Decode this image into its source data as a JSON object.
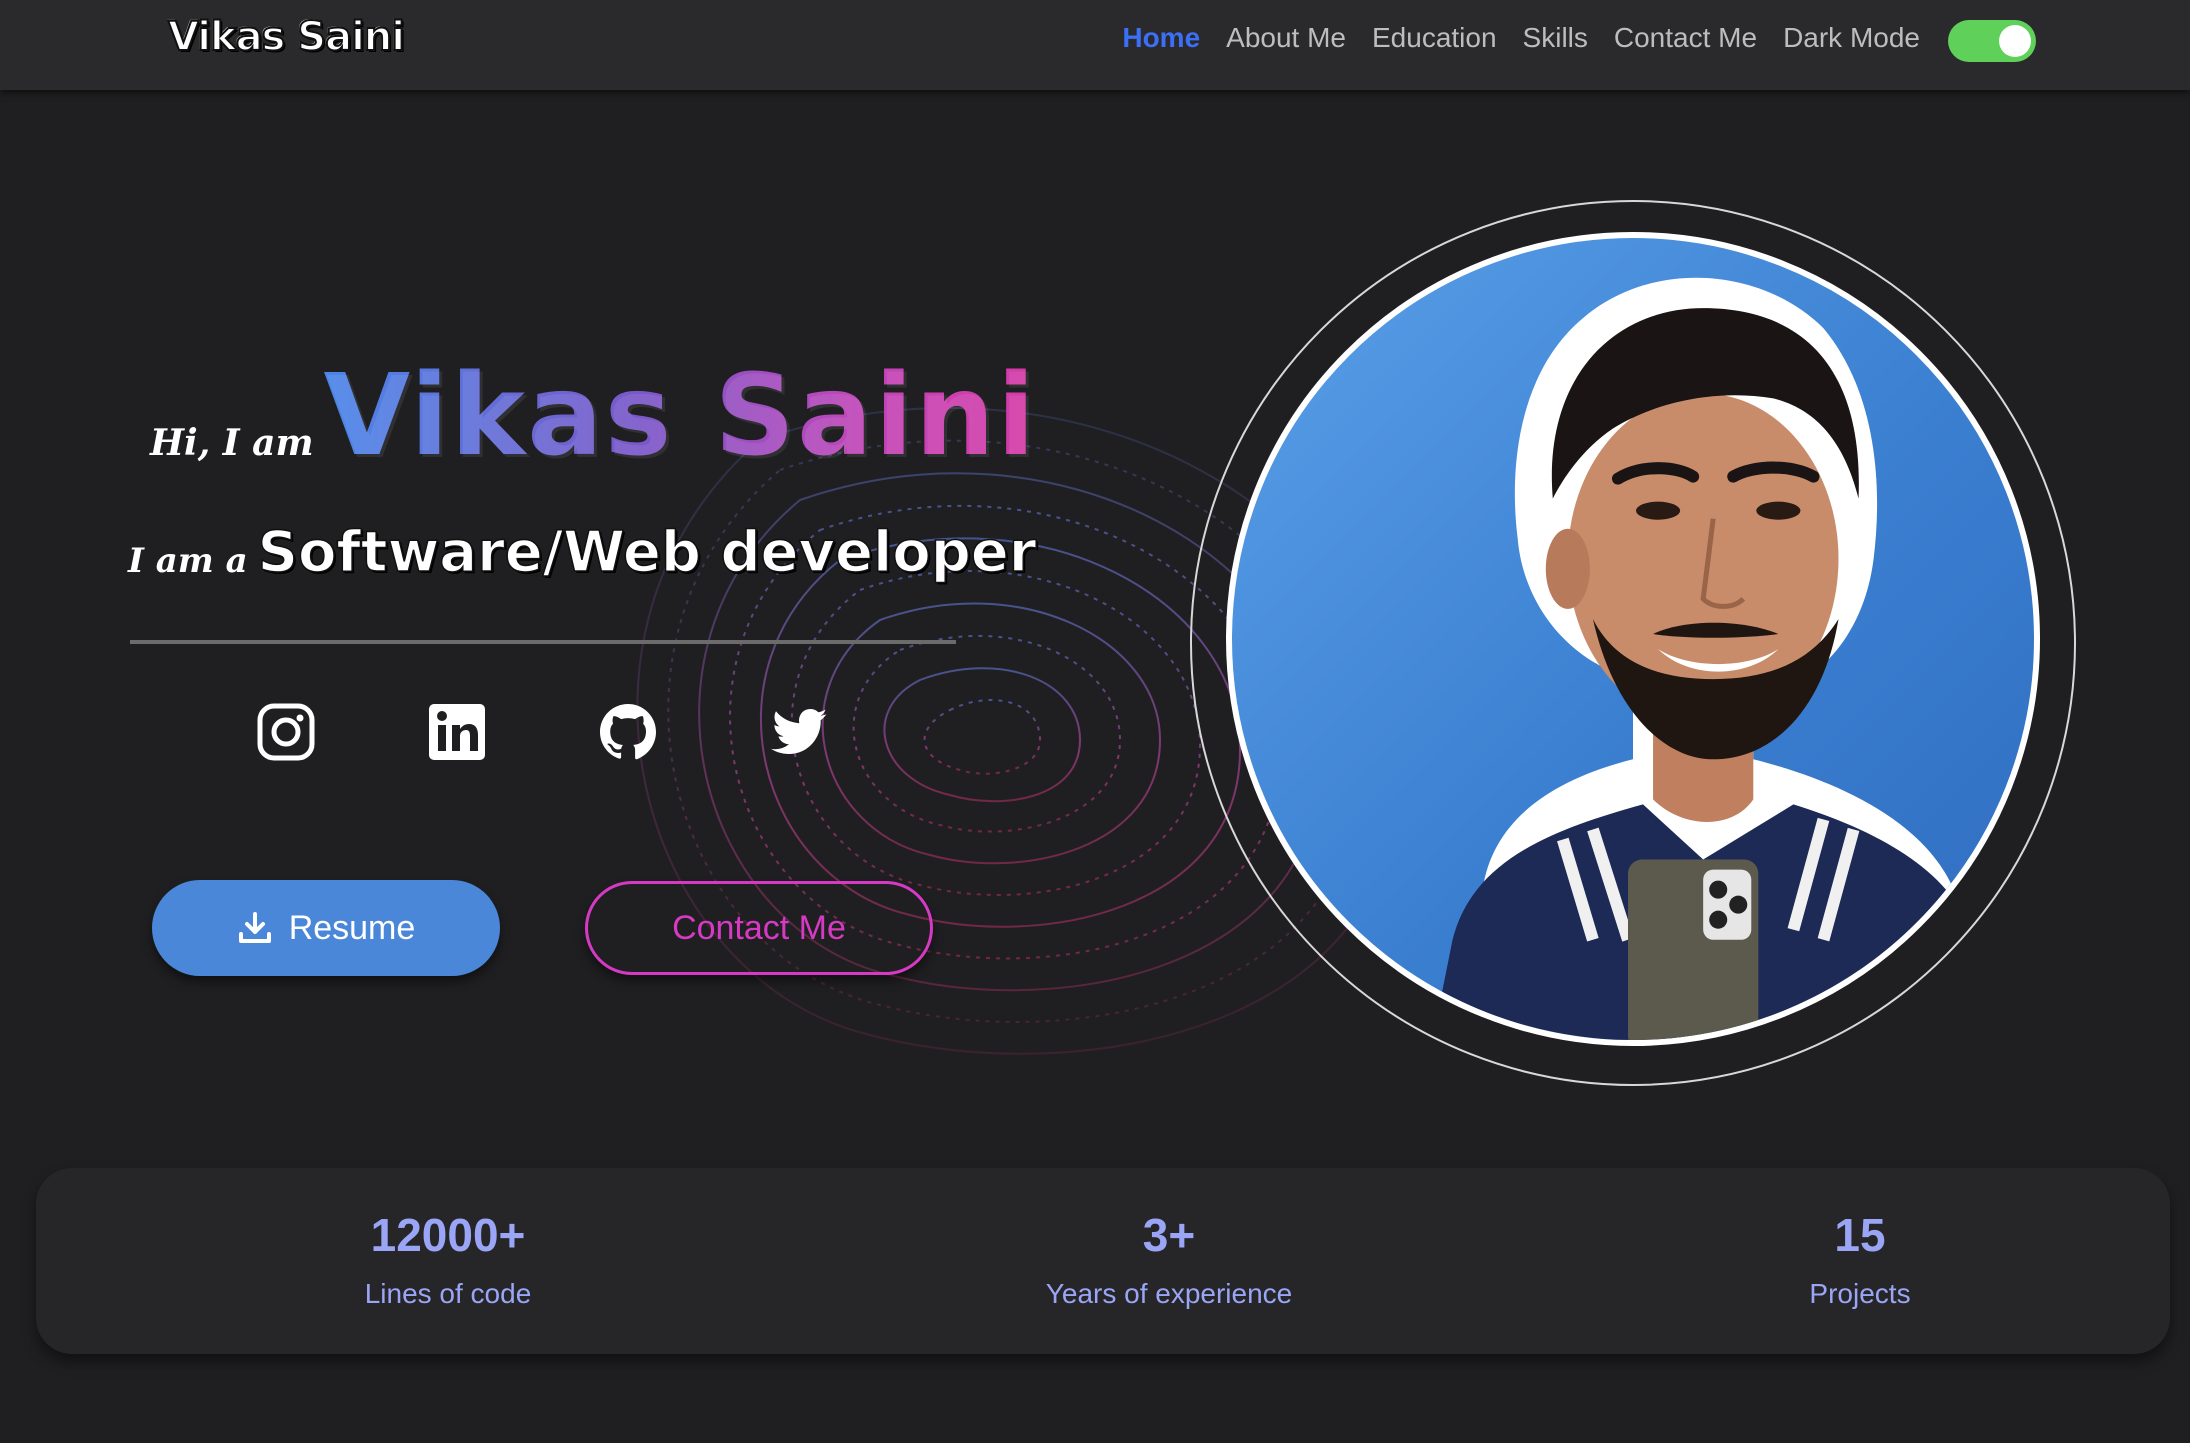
{
  "navbar": {
    "brand": "Vikas Saini",
    "links": [
      "Home",
      "About Me",
      "Education",
      "Skills",
      "Contact Me"
    ],
    "active_link": "Home",
    "dark_mode_label": "Dark Mode",
    "dark_mode_on": true
  },
  "hero": {
    "greeting": "Hi, I am",
    "name": "Vikas Saini",
    "role_prefix": "I am a",
    "role": "Software/Web developer"
  },
  "social": [
    {
      "icon": "instagram-icon"
    },
    {
      "icon": "linkedin-icon"
    },
    {
      "icon": "github-icon"
    },
    {
      "icon": "twitter-icon"
    }
  ],
  "buttons": {
    "resume_label": "Resume",
    "resume_icon": "download-icon",
    "contact_label": "Contact Me"
  },
  "stats": [
    {
      "value": "12000+",
      "label": "Lines of code"
    },
    {
      "value": "3+",
      "label": "Years of experience"
    },
    {
      "value": "15",
      "label": "Projects"
    }
  ],
  "colors": {
    "background": "#1f1f21",
    "navbar": "#2a2a2c",
    "active_link": "#3b6ff5",
    "resume_button": "#4a87d8",
    "contact_button": "#d63ac4",
    "stats_text": "#9aa6f5",
    "toggle_on": "#5fd15a"
  }
}
